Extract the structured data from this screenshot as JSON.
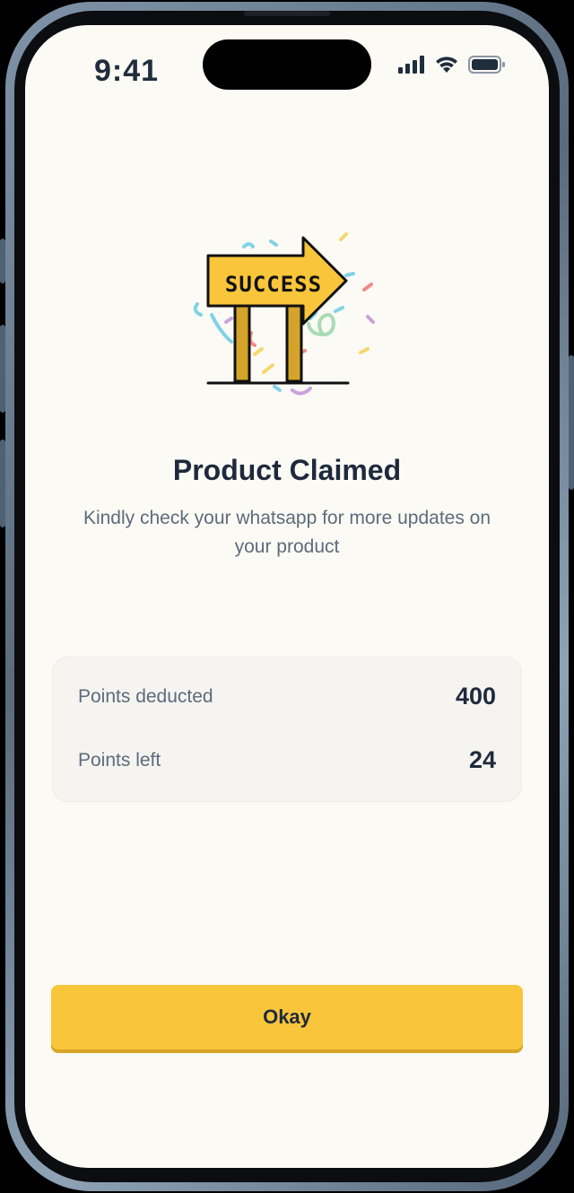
{
  "status_bar": {
    "time": "9:41",
    "icons": [
      "cellular-signal-icon",
      "wifi-icon",
      "battery-icon"
    ]
  },
  "illustration": {
    "sign_text": "SUCCESS",
    "icon": "success-signpost-confetti-illustration"
  },
  "content": {
    "title": "Product Claimed",
    "subtitle": "Kindly check your whatsapp for more updates on your product"
  },
  "points": [
    {
      "label": "Points deducted",
      "value": "400"
    },
    {
      "label": "Points left",
      "value": "24"
    }
  ],
  "actions": {
    "okay_label": "Okay"
  },
  "colors": {
    "screen_background": "#fcfaf5",
    "accent": "#f9c53b",
    "text_primary": "#1e2a3b",
    "text_secondary": "#5d6b7c",
    "card_background": "#f5f4f1"
  }
}
